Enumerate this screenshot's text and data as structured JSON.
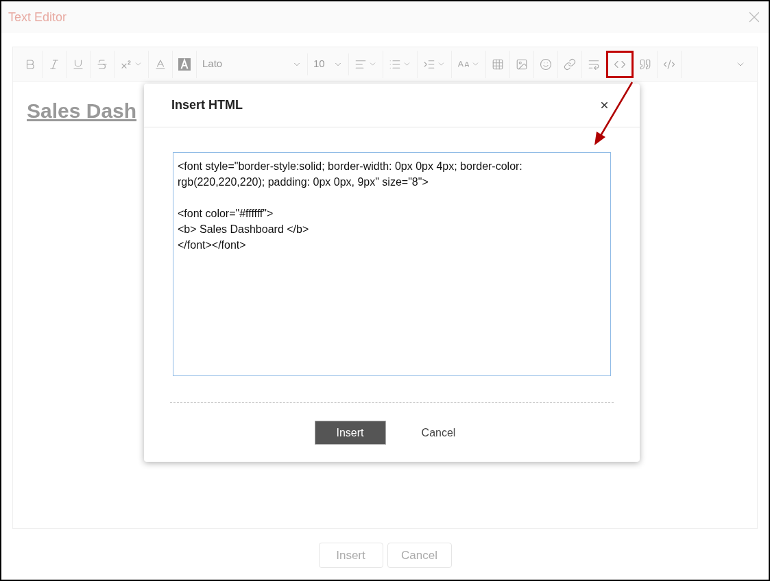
{
  "window": {
    "title": "Text Editor"
  },
  "toolbar": [
    {
      "kind": "button",
      "caret": false,
      "highlighted": false
    },
    {
      "kind": "button",
      "caret": false,
      "highlighted": false
    },
    {
      "kind": "button",
      "caret": false,
      "highlighted": false
    },
    {
      "kind": "button",
      "caret": false,
      "highlighted": false
    },
    {
      "kind": "button",
      "caret": true,
      "highlighted": false
    },
    {
      "kind": "button",
      "caret": false,
      "highlighted": false
    },
    {
      "kind": "button",
      "caret": false,
      "highlighted": false
    },
    {
      "kind": "select",
      "value": "Lato"
    },
    {
      "kind": "select",
      "value": "10"
    },
    {
      "kind": "button",
      "caret": true,
      "highlighted": false
    },
    {
      "kind": "button",
      "caret": true,
      "highlighted": false
    },
    {
      "kind": "button",
      "caret": true,
      "highlighted": false
    },
    {
      "kind": "button",
      "caret": true,
      "highlighted": false
    },
    {
      "kind": "button",
      "caret": false,
      "highlighted": false
    },
    {
      "kind": "button",
      "caret": false,
      "highlighted": false
    },
    {
      "kind": "button",
      "caret": false,
      "highlighted": false
    },
    {
      "kind": "button",
      "caret": false,
      "highlighted": false
    },
    {
      "kind": "button",
      "caret": false,
      "highlighted": false
    },
    {
      "kind": "button",
      "caret": false,
      "highlighted": true
    },
    {
      "kind": "button",
      "caret": false,
      "highlighted": false
    },
    {
      "kind": "button",
      "caret": false,
      "highlighted": false
    }
  ],
  "content": {
    "heading": "Sales Dash"
  },
  "dialog": {
    "title": "Insert HTML",
    "code": "<font style=\"border-style:solid; border-width: 0px 0px 4px; border-color: rgb(220,220,220); padding: 0px 0px, 9px\" size=\"8\">\n\n<font color=\"#ffffff\">\n<b> Sales Dashboard </b>\n</font></font>",
    "buttons": [
      "Insert",
      "Cancel"
    ]
  },
  "footer": {
    "buttons": [
      "Insert",
      "Cancel"
    ]
  }
}
